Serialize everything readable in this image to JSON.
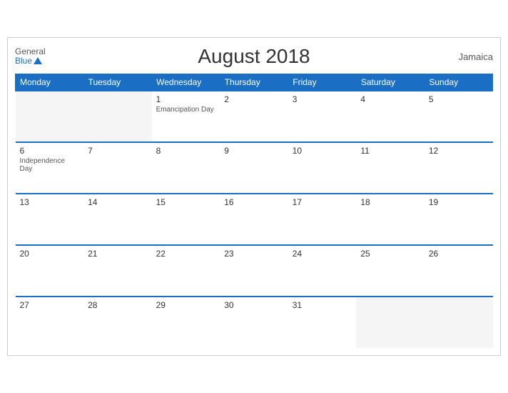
{
  "header": {
    "title": "August 2018",
    "country": "Jamaica",
    "logo_general": "General",
    "logo_blue": "Blue"
  },
  "weekdays": [
    "Monday",
    "Tuesday",
    "Wednesday",
    "Thursday",
    "Friday",
    "Saturday",
    "Sunday"
  ],
  "weeks": [
    [
      {
        "day": "",
        "empty": true
      },
      {
        "day": "",
        "empty": true
      },
      {
        "day": "1",
        "event": "Emancipation Day"
      },
      {
        "day": "2",
        "event": ""
      },
      {
        "day": "3",
        "event": ""
      },
      {
        "day": "4",
        "event": ""
      },
      {
        "day": "5",
        "event": ""
      }
    ],
    [
      {
        "day": "6",
        "event": "Independence Day"
      },
      {
        "day": "7",
        "event": ""
      },
      {
        "day": "8",
        "event": ""
      },
      {
        "day": "9",
        "event": ""
      },
      {
        "day": "10",
        "event": ""
      },
      {
        "day": "11",
        "event": ""
      },
      {
        "day": "12",
        "event": ""
      }
    ],
    [
      {
        "day": "13",
        "event": ""
      },
      {
        "day": "14",
        "event": ""
      },
      {
        "day": "15",
        "event": ""
      },
      {
        "day": "16",
        "event": ""
      },
      {
        "day": "17",
        "event": ""
      },
      {
        "day": "18",
        "event": ""
      },
      {
        "day": "19",
        "event": ""
      }
    ],
    [
      {
        "day": "20",
        "event": ""
      },
      {
        "day": "21",
        "event": ""
      },
      {
        "day": "22",
        "event": ""
      },
      {
        "day": "23",
        "event": ""
      },
      {
        "day": "24",
        "event": ""
      },
      {
        "day": "25",
        "event": ""
      },
      {
        "day": "26",
        "event": ""
      }
    ],
    [
      {
        "day": "27",
        "event": ""
      },
      {
        "day": "28",
        "event": ""
      },
      {
        "day": "29",
        "event": ""
      },
      {
        "day": "30",
        "event": ""
      },
      {
        "day": "31",
        "event": ""
      },
      {
        "day": "",
        "empty": true
      },
      {
        "day": "",
        "empty": true
      }
    ]
  ]
}
